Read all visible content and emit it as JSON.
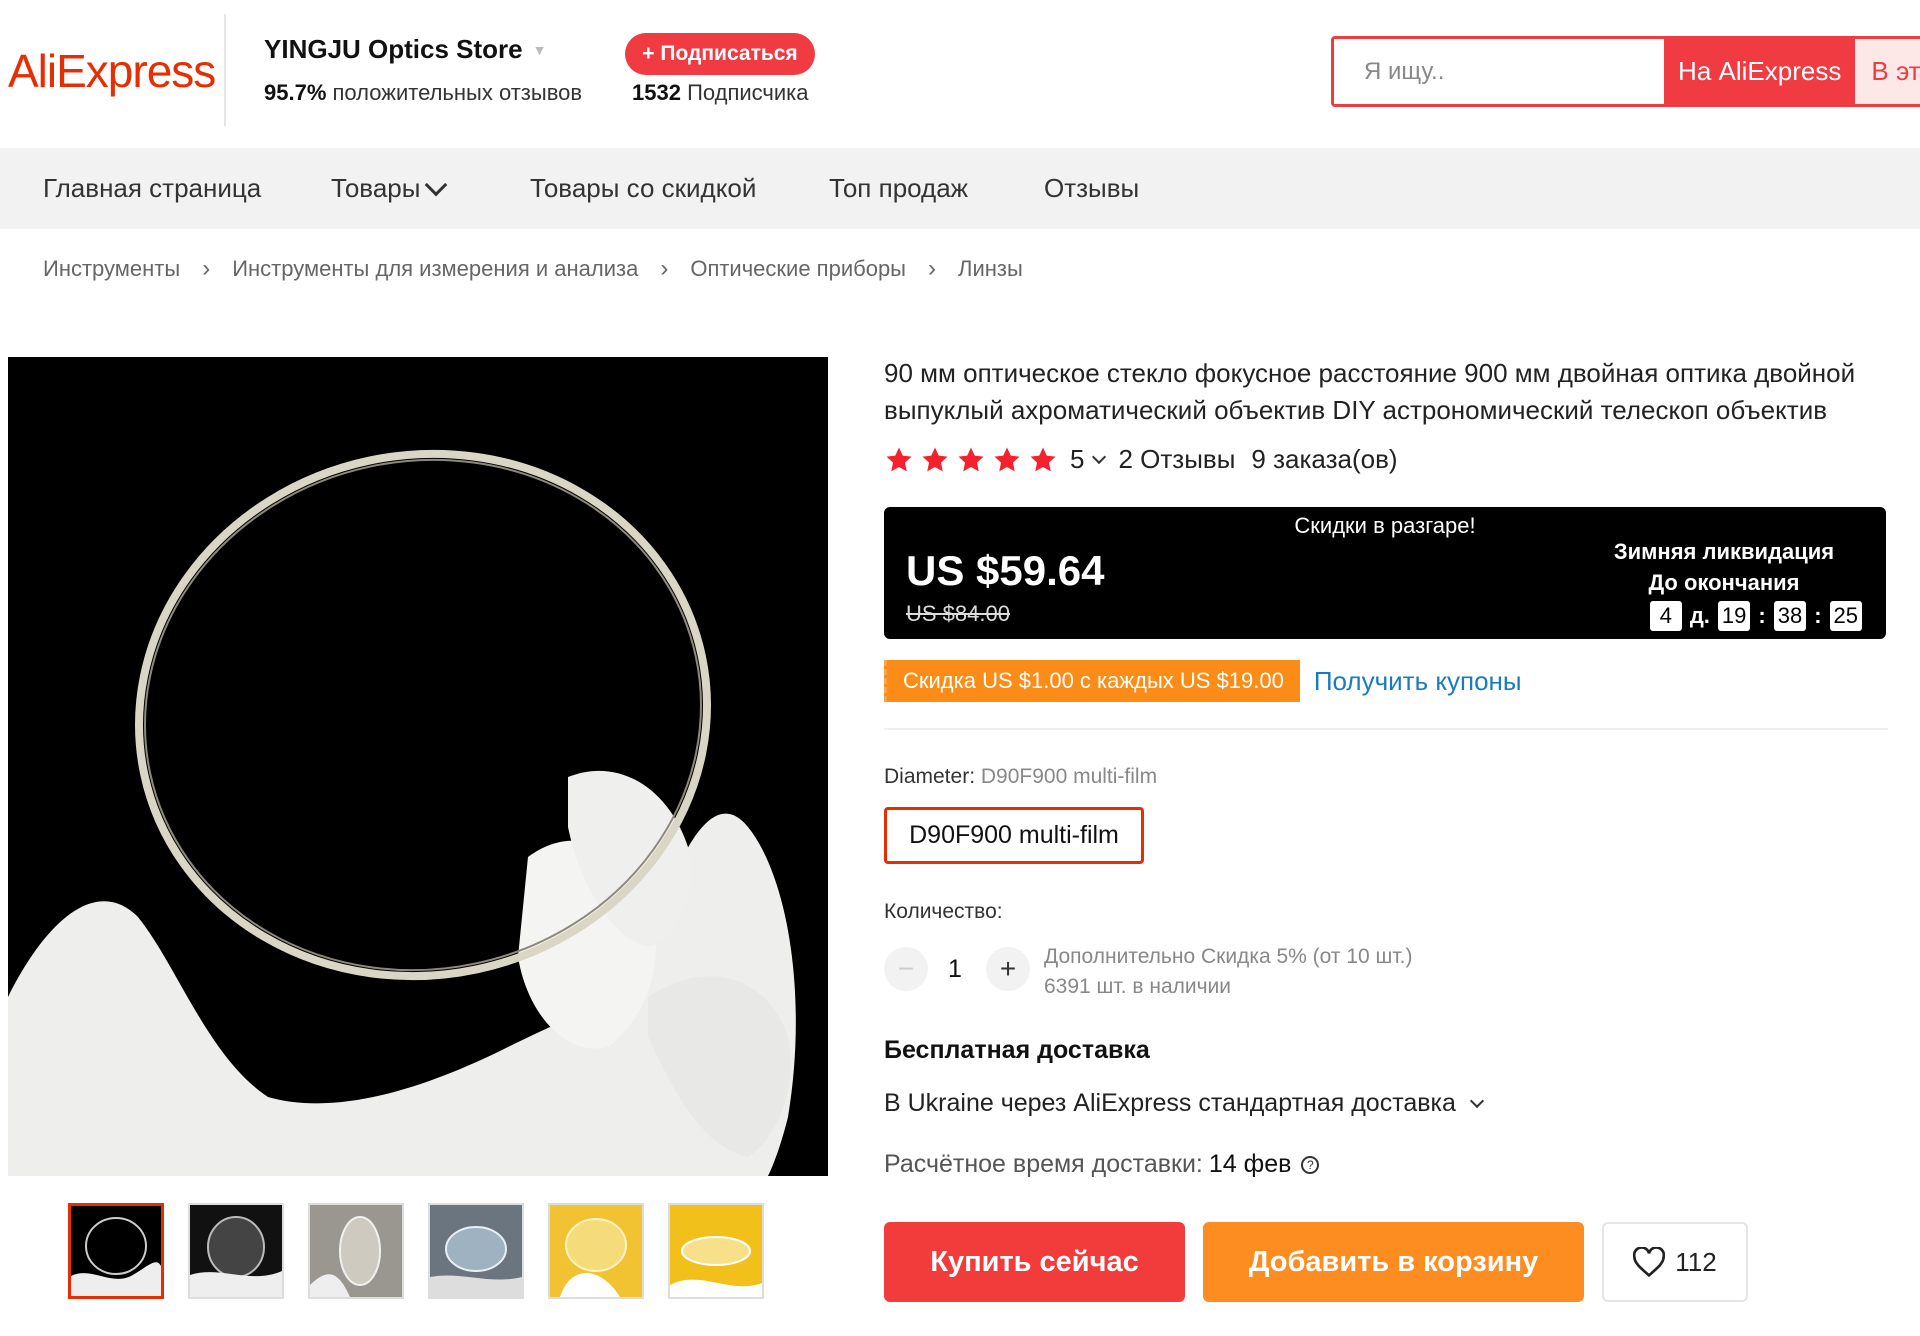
{
  "header": {
    "logo": "AliExpress",
    "store_name": "YINGJU Optics Store",
    "rating_percent": "95.7%",
    "rating_text": "положительных отзывов",
    "subscribe_label": "+ Подписаться",
    "followers_count": "1532",
    "followers_text": "Подписчика",
    "search_placeholder": "Я ищу..",
    "search_ae_label": "На AliExpress",
    "search_store_label": "В этом магазине"
  },
  "nav": {
    "items": [
      "Главная страница",
      "Товары",
      "Товары со скидкой",
      "Топ продаж",
      "Отзывы"
    ]
  },
  "breadcrumb": [
    "Инструменты",
    "Инструменты для измерения и анализа",
    "Оптические приборы",
    "Линзы"
  ],
  "product": {
    "title": "90 мм оптическое стекло фокусное расстояние 900 мм двойная оптика двойной выпуклый ахроматический объектив DIY астрономический телескоп объектив",
    "rating": "5",
    "reviews": "2 Отзывы",
    "orders": "9 заказа(ов)",
    "sale_banner": "Скидки в разгаре!",
    "price": "US $59.64",
    "old_price": "US $84.00",
    "timer_label1": "Зимняя ликвидация",
    "timer_label2": "До окончания",
    "timer": {
      "days": "4",
      "days_unit": "д.",
      "hours": "19",
      "minutes": "38",
      "seconds": "25"
    },
    "coupon_text": "Скидка US $1.00 с каждых US $19.00",
    "coupon_link": "Получить купоны",
    "diameter_label": "Diameter:",
    "diameter_value": "D90F900 multi-film",
    "sku_option": "D90F900 multi-film",
    "quantity_label": "Количество:",
    "quantity": "1",
    "qty_discount": "Дополнительно Скидка 5% (от 10 шт.)",
    "stock": "6391 шт. в наличии",
    "free_shipping": "Бесплатная доставка",
    "ship_method": "В Ukraine через AliExpress стандартная доставка",
    "ship_time_label": "Расчётное время доставки:",
    "ship_time_value": "14 фев",
    "buy_label": "Купить сейчас",
    "cart_label": "Добавить в корзину",
    "wishlist_count": "112"
  },
  "colors": {
    "brand": "#e62e04",
    "buy": "#f23b3b",
    "cart": "#fd8c21",
    "coupon": "#fb8c17",
    "link": "#1a7bbf",
    "star": "#f5222d"
  }
}
